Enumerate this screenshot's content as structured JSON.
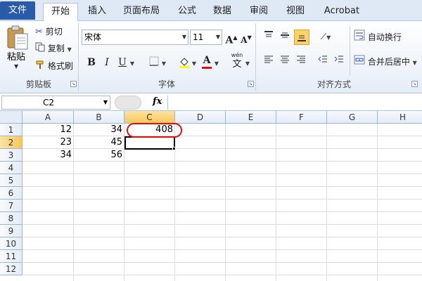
{
  "tabs": [
    {
      "label": "文件"
    },
    {
      "label": "开始"
    },
    {
      "label": "插入"
    },
    {
      "label": "页面布局"
    },
    {
      "label": "公式"
    },
    {
      "label": "数据"
    },
    {
      "label": "审阅"
    },
    {
      "label": "视图"
    },
    {
      "label": "Acrobat"
    }
  ],
  "active_tab": "开始",
  "clipboard": {
    "paste": "粘贴",
    "cut": "剪切",
    "copy": "复制",
    "format_painter": "格式刷",
    "group_label": "剪贴板"
  },
  "font": {
    "name": "宋体",
    "size": "11",
    "grow_label": "A",
    "shrink_label": "A",
    "bold": "B",
    "italic": "I",
    "underline": "U",
    "font_color_label": "A",
    "phonetic_top": "wén",
    "phonetic_bottom": "文",
    "group_label": "字体"
  },
  "alignment": {
    "wrap_text": "自动换行",
    "merge_center": "合并后居中",
    "group_label": "对齐方式"
  },
  "formula_bar": {
    "name_box": "C2",
    "fx": "fx",
    "content": ""
  },
  "sheet": {
    "columns": [
      "A",
      "B",
      "C",
      "D",
      "E",
      "F",
      "G",
      "H"
    ],
    "selected_column": "C",
    "rows": [
      "1",
      "2",
      "3",
      "4",
      "5",
      "6",
      "7",
      "8",
      "9",
      "10",
      "11",
      "12"
    ],
    "selected_row": "2",
    "cells": {
      "A1": "12",
      "B1": "34",
      "C1": "408",
      "A2": "23",
      "B2": "45",
      "A3": "34",
      "B3": "56"
    }
  },
  "colors": {
    "file_tab": "#2a5ba8",
    "ribbon_bg": "#eef3fa",
    "selected_header": "#f7c85a",
    "highlight_ring": "#e01010"
  }
}
